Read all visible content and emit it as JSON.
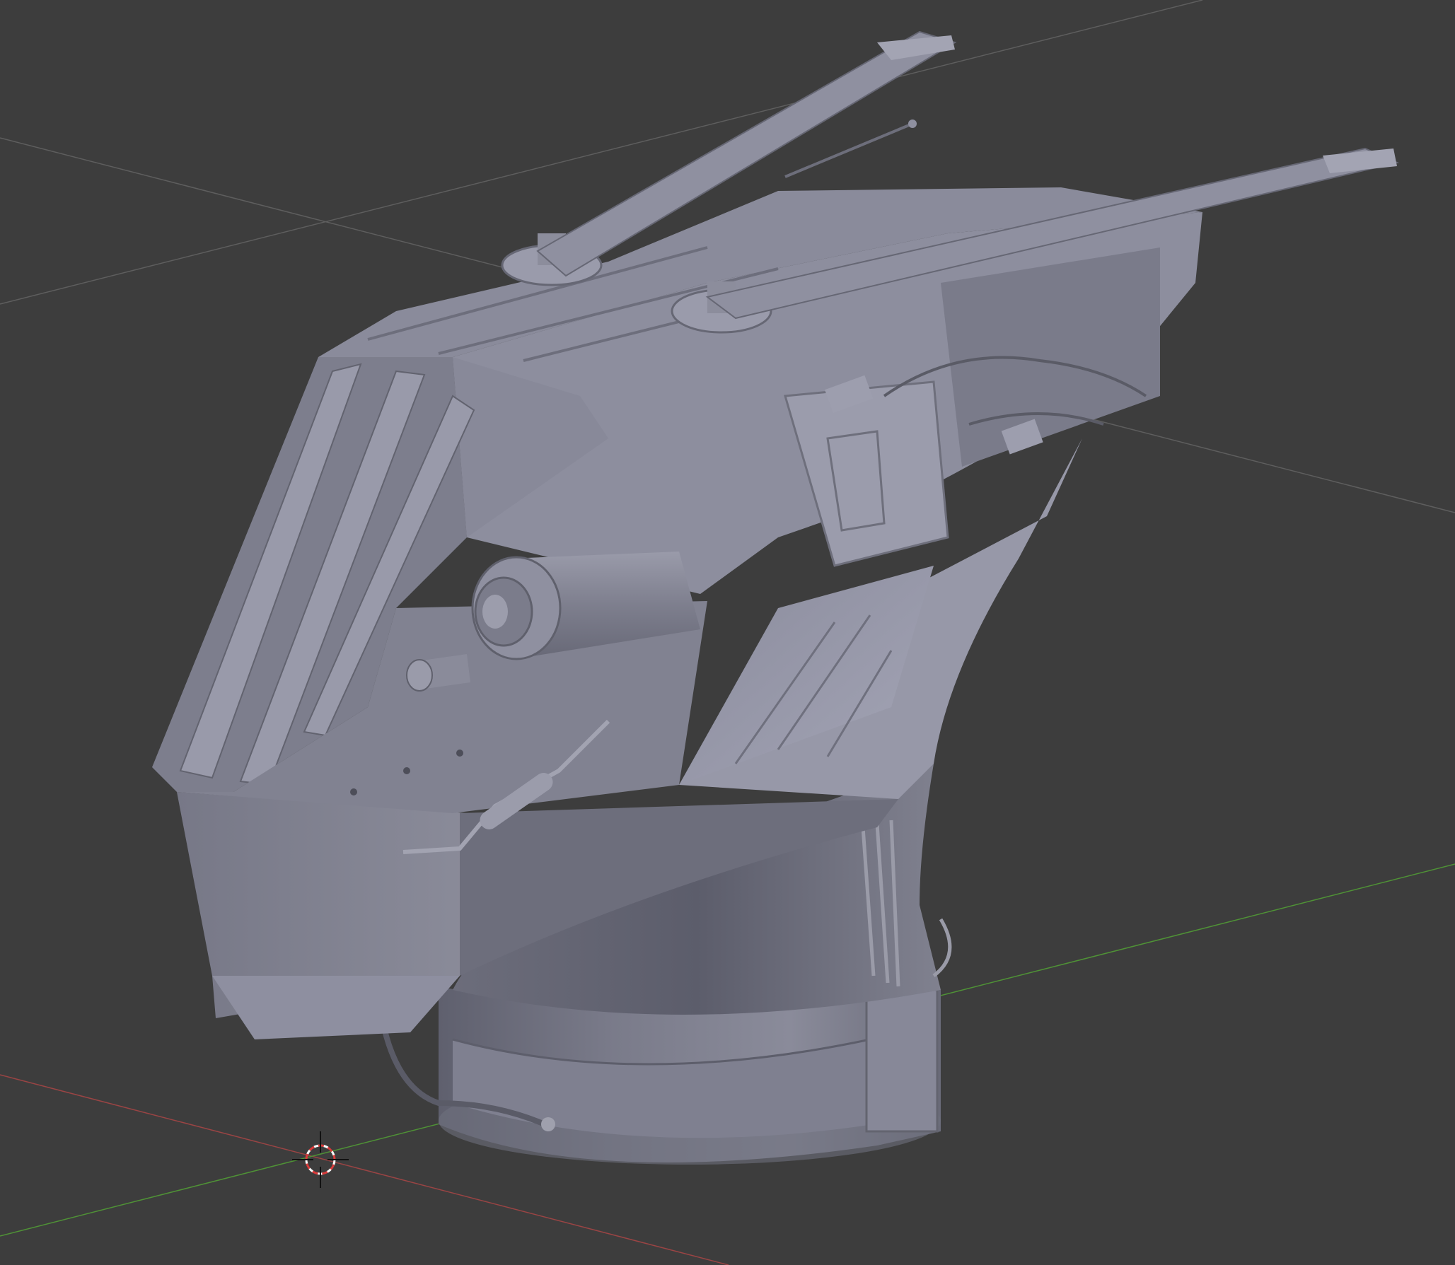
{
  "app": {
    "type": "3D viewport",
    "background_color": "#3d3d3d"
  },
  "viewport": {
    "grid": {
      "visible": true,
      "line_color": "#6a6a6a",
      "x_axis_color": "#b84a4a",
      "y_axis_color": "#5aa63c"
    },
    "cursor": {
      "icon": "3d-cursor-icon",
      "ring_colors": [
        "#ffffff",
        "#d83a3a"
      ]
    },
    "model": {
      "shading": "solid",
      "base_color": "#7e7f8f",
      "light_color": "#9fa0b0",
      "dark_color": "#5d5e6c"
    }
  }
}
